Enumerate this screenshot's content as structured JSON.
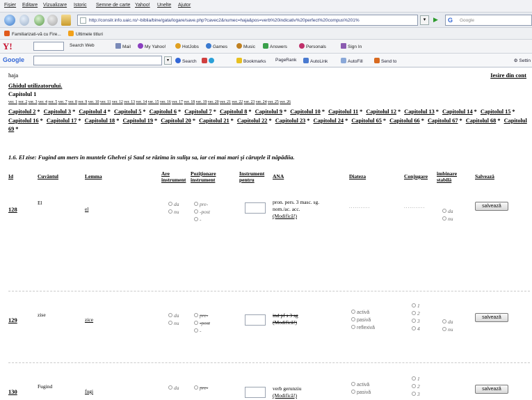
{
  "browser": {
    "menu": [
      "Fișier",
      "Editare",
      "Vizualizare",
      "Istoric",
      "Semne de carte",
      "Yahoo!",
      "Unelte",
      "Ajutor"
    ],
    "url": "http://consilr.info.uaic.ro/~biblia/bine/gata/logare/save.php?cavec2&numec=haja&pos=verb%20indicativ%20perfect%20compus%201%",
    "search_placeholder": "Google",
    "bookmarks": [
      "Familiarizati-vă cu Fire...",
      "Ultimele titluri"
    ],
    "yahoo_toolbar": {
      "logo": "Y!",
      "items": [
        "Search Web",
        "Mail",
        "My Yahoo!",
        "HotJobs",
        "Games",
        "Music",
        "Answers",
        "Personals",
        "Sign In"
      ]
    },
    "google_toolbar": {
      "logo": "Google",
      "items": [
        "Search",
        "Bookmarks",
        "PageRank",
        "AutoLink",
        "AutoFill",
        "Send to"
      ],
      "settings": "Settin"
    }
  },
  "page": {
    "user": "haja",
    "logout": "Iesire din cont",
    "guide": "Ghidul utilizatorului.",
    "chapter_title": "Capitolul 1",
    "verses": [
      "ver. 1",
      "ver. 2",
      "ver. 3",
      "ver. 4",
      "ver. 5",
      "ver. 7",
      "ver. 8",
      "ver. 9",
      "ver. 10",
      "ver. 11",
      "ver. 12",
      "ver. 13",
      "ver. 14",
      "ver. 15",
      "ver. 16",
      "ver. 17",
      "ver. 18",
      "ver. 19",
      "ver. 20",
      "ver. 21",
      "ver. 22",
      "ver. 23",
      "ver. 24",
      "ver. 25",
      "ver. 26"
    ],
    "chapters": [
      "Capitolul 2",
      "Capitolul 3",
      "Capitolul 4",
      "Capitolul 5",
      "Capitolul 6",
      "Capitolul 7",
      "Capitolul 8",
      "Capitolul 9",
      "Capitolul 10",
      "Capitolul 11",
      "Capitolul 12",
      "Capitolul 13",
      "Capitolul 14",
      "Capitolul 15",
      "Capitolul 16",
      "Capitolul 17",
      "Capitolul 18",
      "Capitolul 19",
      "Capitolul 20",
      "Capitolul 21",
      "Capitolul 22",
      "Capitolul 23",
      "Capitolul 24",
      "Capitolul 65",
      "Capitolul 66",
      "Capitolul 67",
      "Capitolul 68",
      "Capitolul 69"
    ],
    "chapter_separator": "*",
    "sentence": "1.6. El zise: Fugind am mers în muntele Ghelvei şi Saul se rǎzima în suliţa sa, iar cei mai mari şi cǎruţele îl nǎpǎdiia."
  },
  "table": {
    "headers": {
      "id": "Id",
      "word": "Cuvântul",
      "lemma": "Lemma",
      "has_instr": "Are instrument",
      "pos_instr": "Poziţionare instrument",
      "instr_for": "Instrument pentru",
      "ana": "ANA",
      "diateza": "Diateza",
      "conj": "Conjugare",
      "stable": "îmbinare stabilă",
      "save": "Salvează"
    },
    "options": {
      "da": "da",
      "nu": "nu",
      "pre": "pre-",
      "post": "-post",
      "none": "-",
      "activa": "activă",
      "pasiva": "pasivă",
      "reflexiva": "reflexivă",
      "c1": "1",
      "c2": "2",
      "c3": "3",
      "c4": "4"
    },
    "rows": [
      {
        "id": "128",
        "word": "El",
        "lemma": "el",
        "ana_1": "pron. pers. 3 masc. sg.",
        "ana_2": "nom./ac. acc.",
        "ana_link": "(Modifică!)",
        "diateza": "...........",
        "conj": "...........",
        "save": "salvează"
      },
      {
        "id": "129",
        "word": "zise",
        "lemma": "zice",
        "ana_1": "ind pf s 3 sg",
        "ana_link": "(Modifică!)",
        "save": "salvează"
      },
      {
        "id": "130",
        "word": "Fugind",
        "lemma": "fugi",
        "ana_1": "verb gerunziu",
        "ana_link": "(Modifică!)",
        "save": "salvează"
      }
    ]
  }
}
